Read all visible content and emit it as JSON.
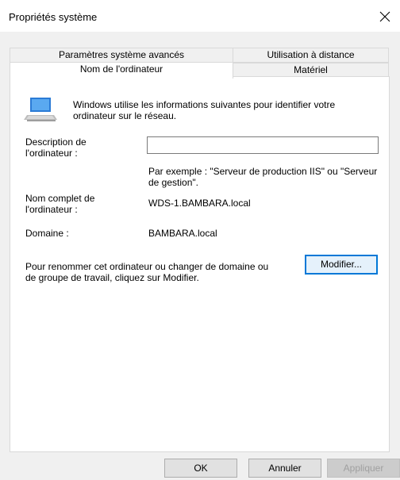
{
  "window": {
    "title": "Propriétés système"
  },
  "tabs": {
    "row1": [
      "Paramètres système avancés",
      "Utilisation à distance"
    ],
    "row2": [
      "Nom de l'ordinateur",
      "Matériel"
    ]
  },
  "intro": "Windows utilise les informations suivantes pour identifier votre ordinateur sur le réseau.",
  "fields": {
    "description_label": "Description de l'ordinateur :",
    "description_value": "",
    "description_hint": "Par exemple : \"Serveur de production IIS\" ou \"Serveur de gestion\".",
    "fullname_label": "Nom complet de l'ordinateur :",
    "fullname_value": "WDS-1.BAMBARA.local",
    "domain_label": "Domaine :",
    "domain_value": "BAMBARA.local"
  },
  "rename": {
    "text": "Pour renommer cet ordinateur ou changer de domaine ou de groupe de travail, cliquez sur Modifier.",
    "button": "Modifier..."
  },
  "buttons": {
    "ok": "OK",
    "cancel": "Annuler",
    "apply": "Appliquer"
  },
  "icons": {
    "close": "close-icon",
    "computer": "computer-icon"
  }
}
